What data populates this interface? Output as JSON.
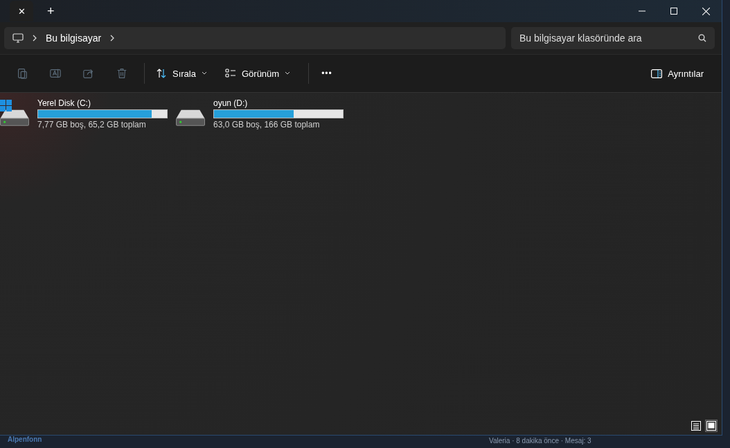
{
  "title_bar": {
    "tab_close": "✕",
    "new_tab": "+"
  },
  "address_bar": {
    "crumbs": [
      "Bu bilgisayar"
    ]
  },
  "search": {
    "placeholder": "Bu bilgisayar klasöründe ara"
  },
  "toolbar": {
    "actions": [
      {
        "kind": "paste",
        "disabled": true
      },
      {
        "kind": "rename",
        "disabled": true
      },
      {
        "kind": "share",
        "disabled": true
      },
      {
        "kind": "delete",
        "disabled": true
      }
    ],
    "sort": "Sırala",
    "view": "Görünüm",
    "more": "•••",
    "details": "Ayrıntılar"
  },
  "drives": [
    {
      "name": "Yerel Disk (C:)",
      "system": true,
      "level": 0.88,
      "info": "7,77 GB boş, 65,2 GB toplam"
    },
    {
      "name": "oyun (D:)",
      "system": false,
      "level": 0.62,
      "info": "63,0 GB boş, 166 GB toplam"
    }
  ],
  "view_modes": [
    {
      "kind": "details",
      "selected": false
    },
    {
      "kind": "tiles",
      "selected": true
    }
  ],
  "background": {
    "left_text": "Alpenfonn",
    "right_text": "Valeria · 8 dakika önce · Mesaj: 3"
  }
}
